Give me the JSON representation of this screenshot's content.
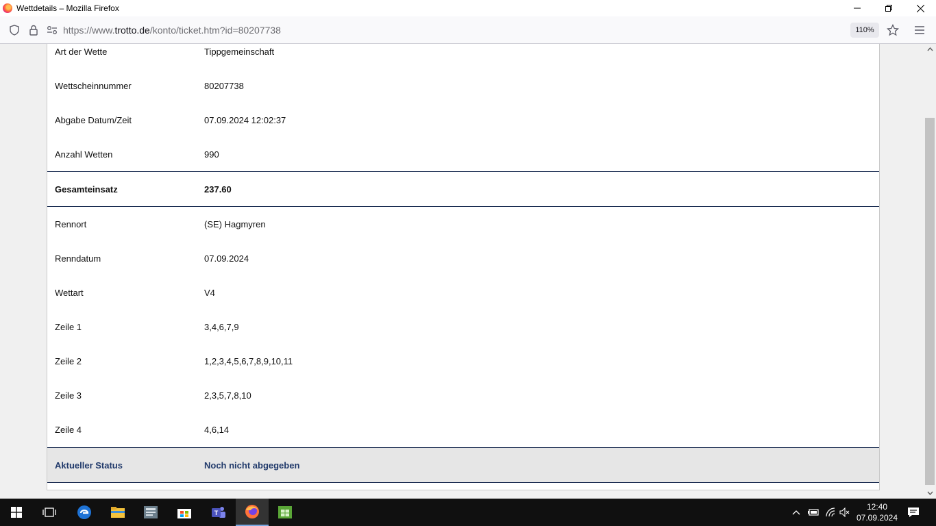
{
  "window": {
    "title": "Wettdetails – Mozilla Firefox"
  },
  "navbar": {
    "url_prefix": "https://www.",
    "url_host": "trotto.de",
    "url_path": "/konto/ticket.htm?id=80207738",
    "zoom": "110%"
  },
  "ticket": {
    "rows": [
      {
        "label": "Art der Wette",
        "value": "Tippgemeinschaft"
      },
      {
        "label": "Wettscheinnummer",
        "value": "80207738"
      },
      {
        "label": "Abgabe Datum/Zeit",
        "value": "07.09.2024 12:02:37"
      },
      {
        "label": "Anzahl Wetten",
        "value": "990"
      }
    ],
    "total": {
      "label": "Gesamteinsatz",
      "value": "237.60"
    },
    "race_rows": [
      {
        "label": "Rennort",
        "value": "(SE) Hagmyren"
      },
      {
        "label": "Renndatum",
        "value": "07.09.2024"
      },
      {
        "label": "Wettart",
        "value": "V4"
      },
      {
        "label": "Zeile 1",
        "value": "3,4,6,7,9"
      },
      {
        "label": "Zeile 2",
        "value": "1,2,3,4,5,6,7,8,9,10,11"
      },
      {
        "label": "Zeile 3",
        "value": "2,3,5,7,8,10"
      },
      {
        "label": "Zeile 4",
        "value": "4,6,14"
      }
    ],
    "status": {
      "label": "Aktueller Status",
      "value": "Noch nicht abgegeben"
    }
  },
  "taskbar": {
    "time": "12:40",
    "date": "07.09.2024"
  },
  "colors": {
    "status_text": "#213a6b",
    "divider": "#1c2e52"
  }
}
